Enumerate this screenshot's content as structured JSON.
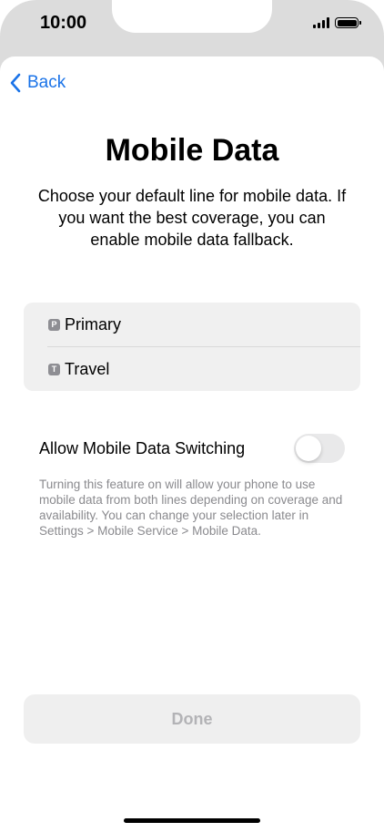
{
  "status_bar": {
    "time": "10:00",
    "icons": [
      "signal-icon",
      "battery-icon"
    ]
  },
  "nav": {
    "back_label": "Back"
  },
  "header": {
    "title": "Mobile Data",
    "subtitle": "Choose your default line for mobile data. If you want the best coverage, you can enable mobile data fallback."
  },
  "lines": [
    {
      "badge": "P",
      "label": "Primary"
    },
    {
      "badge": "T",
      "label": "Travel"
    }
  ],
  "switching": {
    "label": "Allow Mobile Data Switching",
    "enabled": false,
    "footnote": "Turning this feature on will allow your phone to use mobile data from both lines depending on coverage and availability. You can change your selection later in Settings > Mobile Service > Mobile Data."
  },
  "footer": {
    "done_label": "Done"
  },
  "colors": {
    "accent": "#1a73e8",
    "disabled_text": "#b3b3b6",
    "footnote_text": "#8a8a8e"
  }
}
